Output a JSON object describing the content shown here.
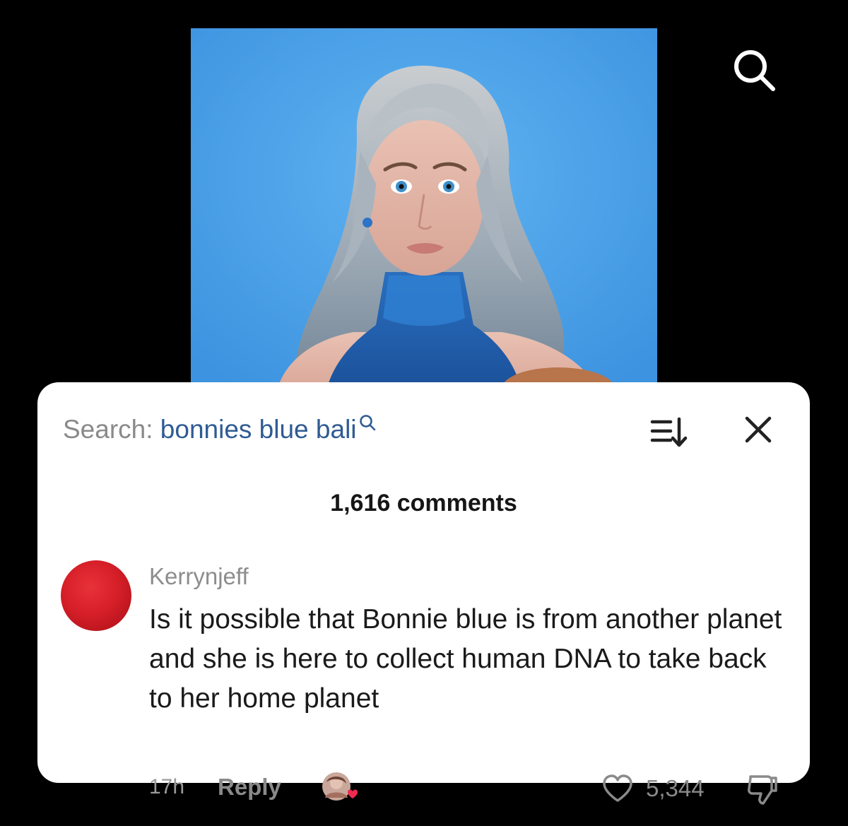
{
  "video": {
    "background_color": "#4aa3ea",
    "search_icon": "search-icon"
  },
  "comments_sheet": {
    "search_prefix": "Search: ",
    "search_query": "bonnies blue bali",
    "query_color": "#2f5b93",
    "sort_icon": "sort-icon",
    "close_icon": "close-icon",
    "comment_count": "1,616 comments"
  },
  "comment": {
    "avatar_color": "#d61f28",
    "username": "Kerrynjeff",
    "text": "Is it possible that Bonnie blue is from another planet and she is here to collect human DNA to take back to her home planet",
    "time": "17h",
    "reply_label": "Reply",
    "like_count": "5,344",
    "like_icon": "heart-outline-icon",
    "dislike_icon": "thumbs-down-icon",
    "creator_liked_icon": "creator-liked-avatar"
  }
}
